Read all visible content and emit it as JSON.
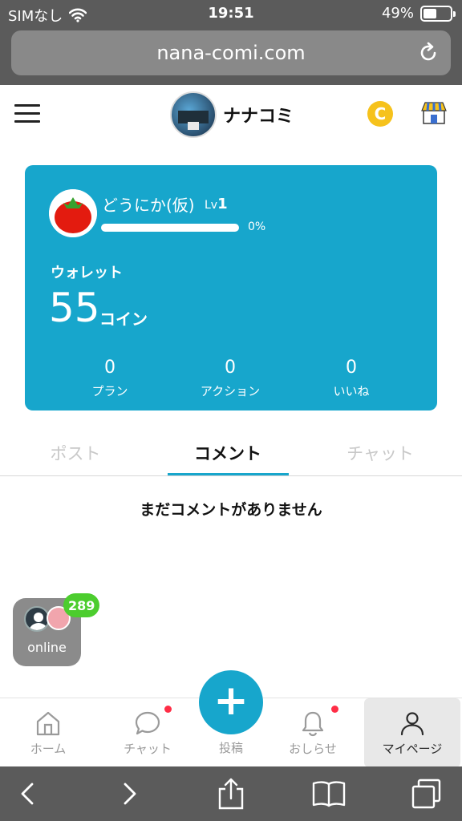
{
  "status_bar": {
    "carrier": "SIMなし",
    "time": "19:51",
    "battery_pct": "49%",
    "battery_level": 0.49,
    "icons": [
      "wifi-icon",
      "battery-icon"
    ]
  },
  "browser": {
    "url": "nana-comi.com",
    "icons": [
      "reload-icon",
      "back-icon",
      "forward-icon",
      "share-icon",
      "bookmarks-icon",
      "tabs-icon"
    ]
  },
  "header": {
    "brand_name": "ナナコミ",
    "coin_badge": "C",
    "icons": [
      "menu-icon",
      "coin-icon",
      "shop-icon"
    ]
  },
  "profile": {
    "username": "どうにか(仮)",
    "level_prefix": "Lv",
    "level_value": "1",
    "progress_label": "0%",
    "progress_value": 0,
    "wallet_label": "ウォレット",
    "wallet_amount": "55",
    "wallet_unit": "コイン",
    "stats": [
      {
        "value": "0",
        "label": "プラン"
      },
      {
        "value": "0",
        "label": "アクション"
      },
      {
        "value": "0",
        "label": "いいね"
      }
    ]
  },
  "tabs": [
    {
      "label": "ポスト",
      "active": false
    },
    {
      "label": "コメント",
      "active": true
    },
    {
      "label": "チャット",
      "active": false
    }
  ],
  "content": {
    "empty_message": "まだコメントがありません"
  },
  "online_widget": {
    "label": "online",
    "count": "289"
  },
  "bottom_nav": {
    "items": [
      {
        "label": "ホーム",
        "icon": "home-icon",
        "active": false,
        "dot": false
      },
      {
        "label": "チャット",
        "icon": "chat-icon",
        "active": false,
        "dot": true
      },
      {
        "label": "投稿",
        "icon": "plus-icon",
        "active": false,
        "dot": false
      },
      {
        "label": "おしらせ",
        "icon": "bell-icon",
        "active": false,
        "dot": true
      },
      {
        "label": "マイページ",
        "icon": "user-icon",
        "active": true,
        "dot": false
      }
    ],
    "post_symbol": "+"
  },
  "colors": {
    "accent": "#17a6cc",
    "badge_green": "#4ccd2e",
    "notification_red": "#ff2d46",
    "coin_yellow": "#f6c21c"
  }
}
